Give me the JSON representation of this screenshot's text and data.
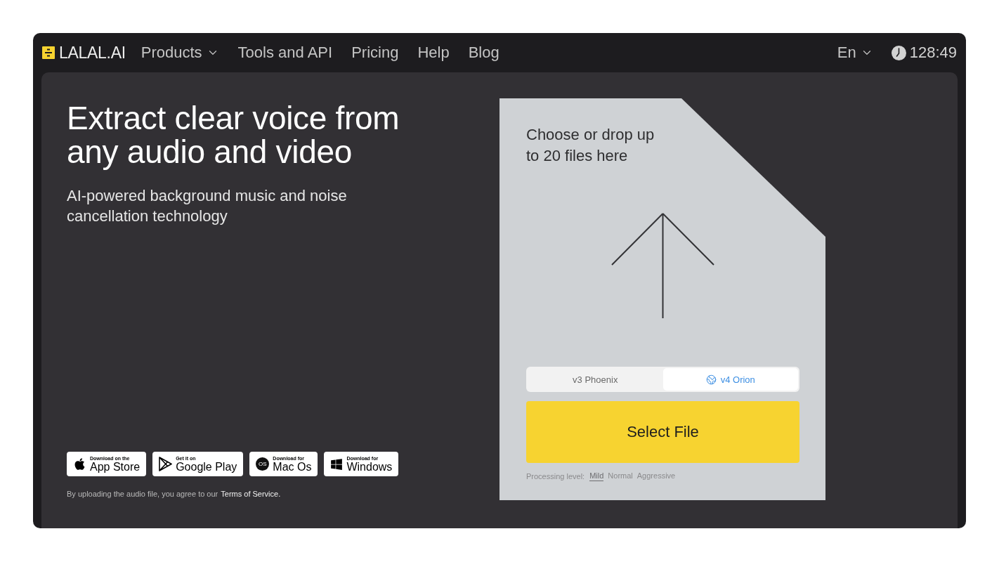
{
  "header": {
    "logo": "LALAL.AI",
    "nav": [
      {
        "label": "Products",
        "has_menu": true
      },
      {
        "label": "Tools and API",
        "has_menu": false
      },
      {
        "label": "Pricing",
        "has_menu": false
      },
      {
        "label": "Help",
        "has_menu": false
      },
      {
        "label": "Blog",
        "has_menu": false
      }
    ],
    "language": "En",
    "timer": "128:49"
  },
  "hero": {
    "title": "Extract clear voice from any audio and video",
    "subtitle": "AI-powered background music and noise cancellation technology"
  },
  "downloads": [
    {
      "kind": "apple",
      "caption": "Download on the",
      "store": "App Store"
    },
    {
      "kind": "google-play",
      "caption": "Get it on",
      "store": "Google Play"
    },
    {
      "kind": "macos",
      "icon_text": "OS",
      "caption": "Download for",
      "store": "Mac Os"
    },
    {
      "kind": "windows",
      "caption": "Download for",
      "store": "Windows"
    }
  ],
  "consent": {
    "text": "By uploading the audio file, you agree to our",
    "link": "Terms of Service."
  },
  "upload": {
    "prompt": "Choose or drop up to 20 files here",
    "models": [
      {
        "label": "v3 Phoenix",
        "selected": false
      },
      {
        "label": "v4 Orion",
        "selected": true
      }
    ],
    "button": "Select File",
    "processing": {
      "label": "Processing level:",
      "options": [
        {
          "label": "Mild",
          "selected": true
        },
        {
          "label": "Normal",
          "selected": false
        },
        {
          "label": "Aggressive",
          "selected": false
        }
      ]
    }
  }
}
